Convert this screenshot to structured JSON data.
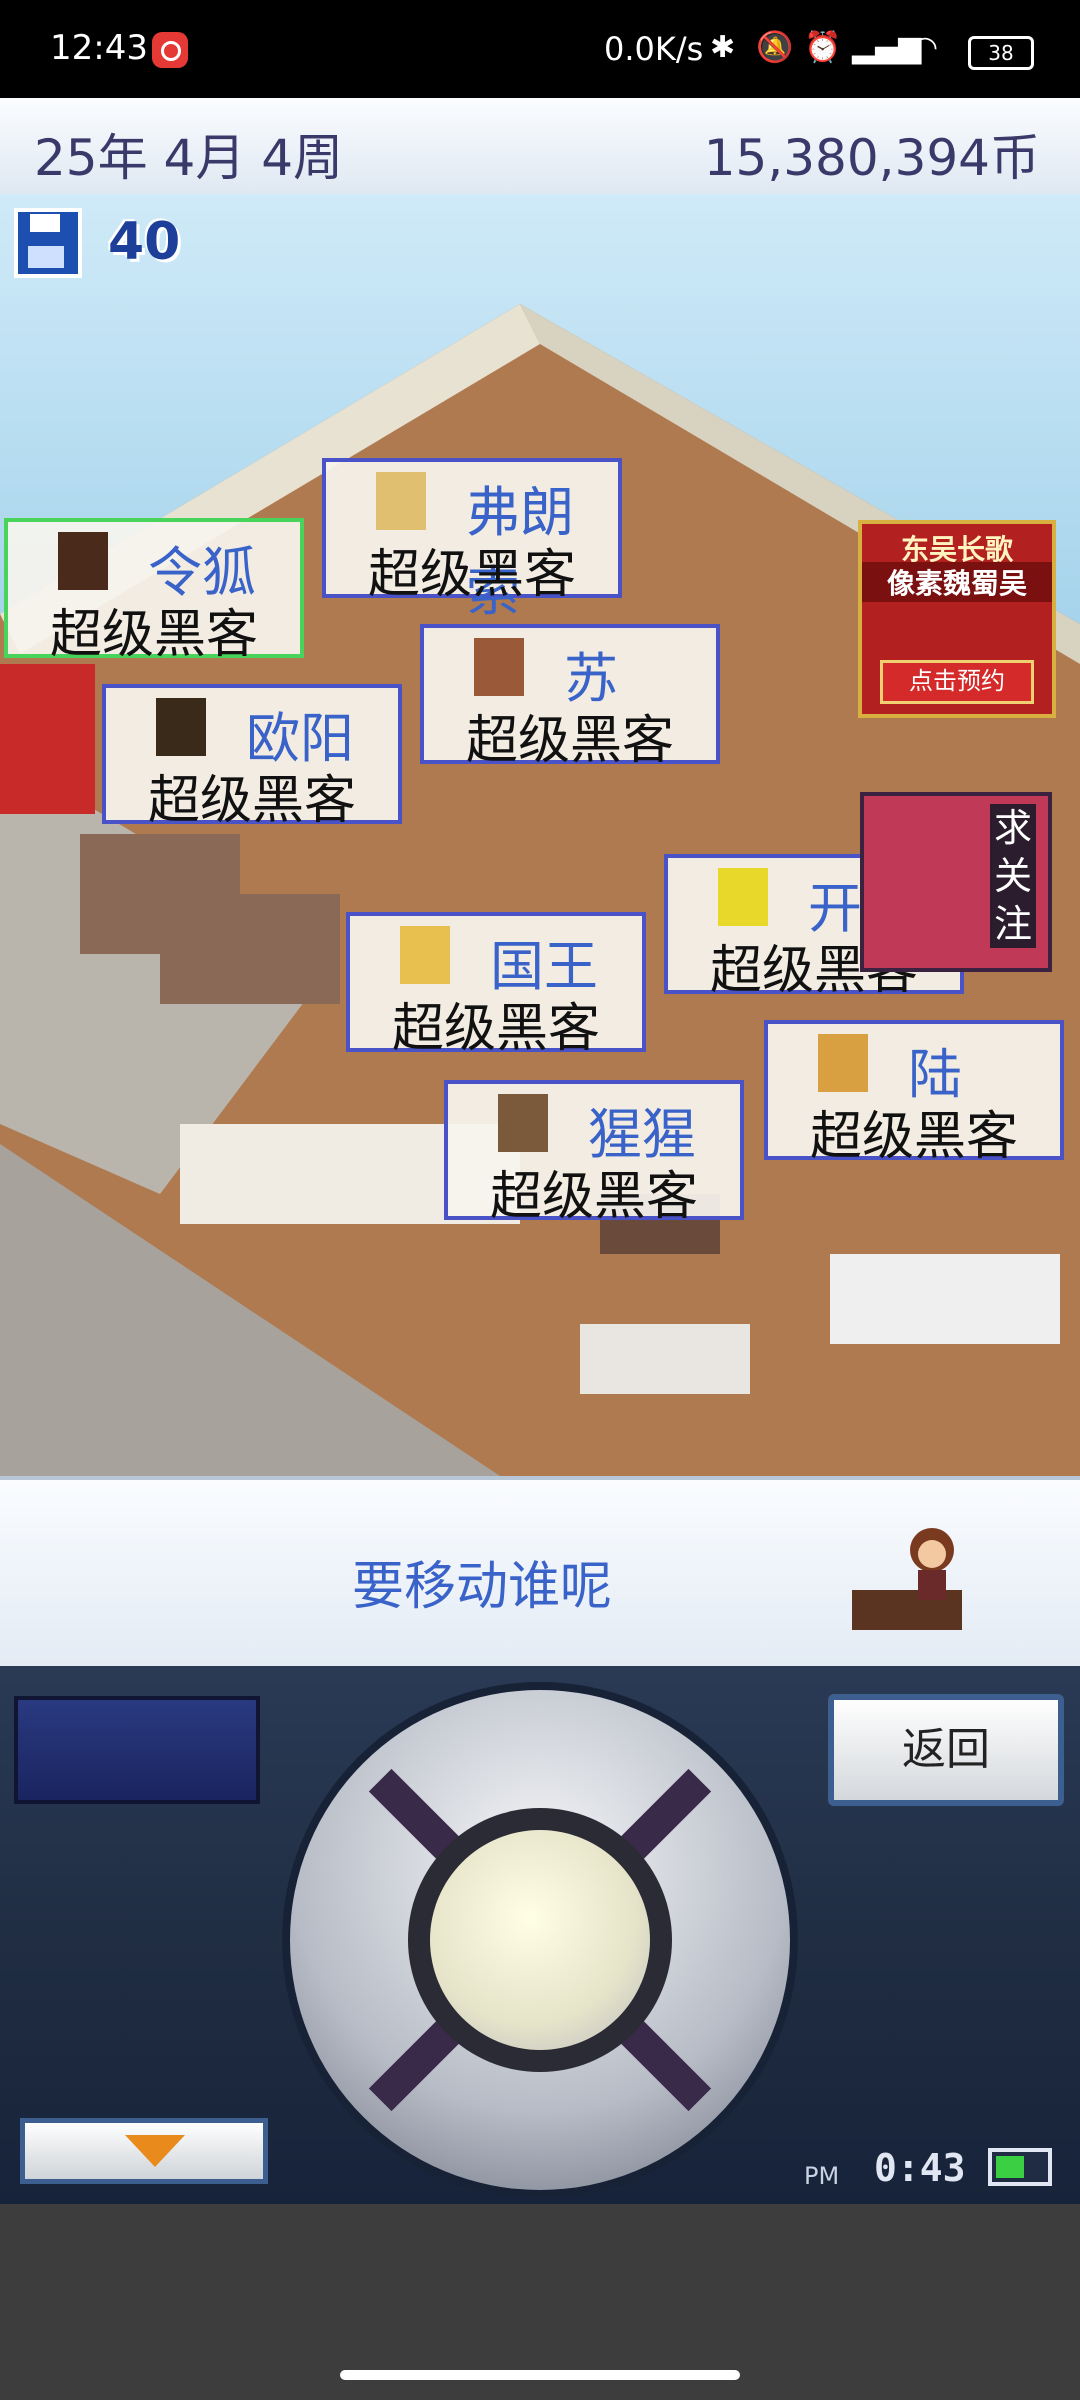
{
  "status_bar": {
    "time": "12:43",
    "network_speed": "0.0K/s",
    "battery": "38"
  },
  "game": {
    "date": "25年 4月 4周",
    "money": "15,380,394币",
    "save_count": "40",
    "staff": [
      {
        "name": "令狐",
        "role": "超级黑客",
        "selected": true
      },
      {
        "name": "弗朗索",
        "role": "超级黑客"
      },
      {
        "name": "苏",
        "role": "超级黑客"
      },
      {
        "name": "欧阳",
        "role": "超级黑客"
      },
      {
        "name": "开罗",
        "role": "超级黑客"
      },
      {
        "name": "国王",
        "role": "超级黑客"
      },
      {
        "name": "陆",
        "role": "超级黑客"
      },
      {
        "name": "猩猩",
        "role": "超级黑客"
      }
    ],
    "ad": {
      "line1": "东吴长歌",
      "line2": "像素魏蜀吴",
      "cta": "点击预约"
    },
    "sign_text": "求关注",
    "message": "要移动谁呢",
    "back_label": "返回",
    "meridiem": "PM",
    "clock": "0:43"
  },
  "colors": {
    "tag_border": "#4a52c8",
    "tag_selected_border": "#48d35a",
    "name_text": "#3a63c9"
  }
}
